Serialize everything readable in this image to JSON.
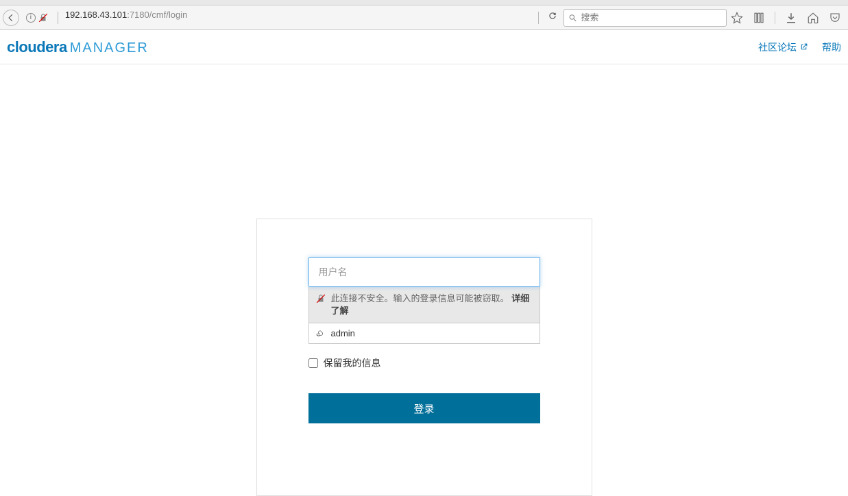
{
  "browser": {
    "url_host": "192.168.43.101",
    "url_path": ":7180/cmf/login",
    "search_placeholder": "搜索"
  },
  "header": {
    "logo_primary": "cloudera",
    "logo_secondary": "MANAGER",
    "community_link": "社区论坛",
    "help_link": "帮助"
  },
  "login": {
    "username_placeholder": "用户名",
    "username_value": "",
    "insecure_msg": "此连接不安全。输入的登录信息可能被窃取。",
    "insecure_detail": "详细了解",
    "suggestion_user": "admin",
    "remember_label": "保留我的信息",
    "submit_label": "登录"
  }
}
